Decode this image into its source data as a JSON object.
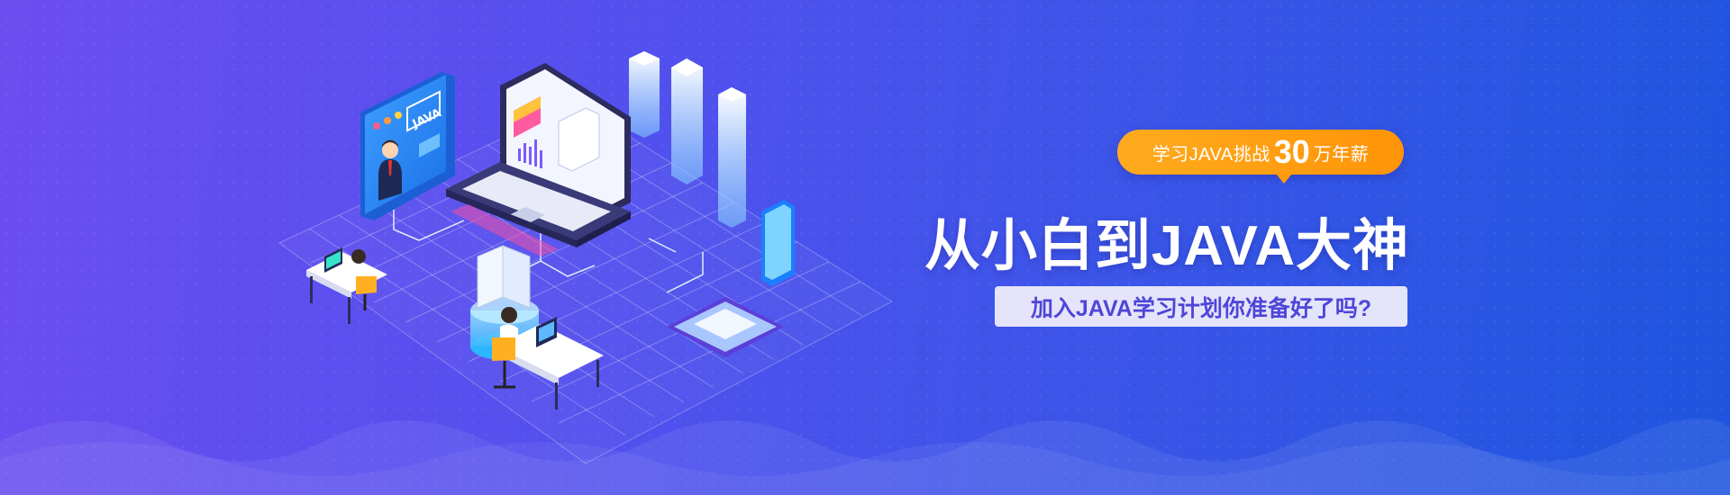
{
  "banner": {
    "promo": {
      "prefix": "学习JAVA挑战",
      "number": "30",
      "suffix": "万年薪"
    },
    "headline": "从小白到JAVA大神",
    "subline": "加入JAVA学习计划你准备好了吗?",
    "illustration": {
      "screen_badge": "JAVA"
    },
    "colors": {
      "bg_start": "#6c4df0",
      "bg_end": "#1e55de",
      "accent": "#ff9b0f",
      "subline_text": "#4f46d8"
    }
  }
}
